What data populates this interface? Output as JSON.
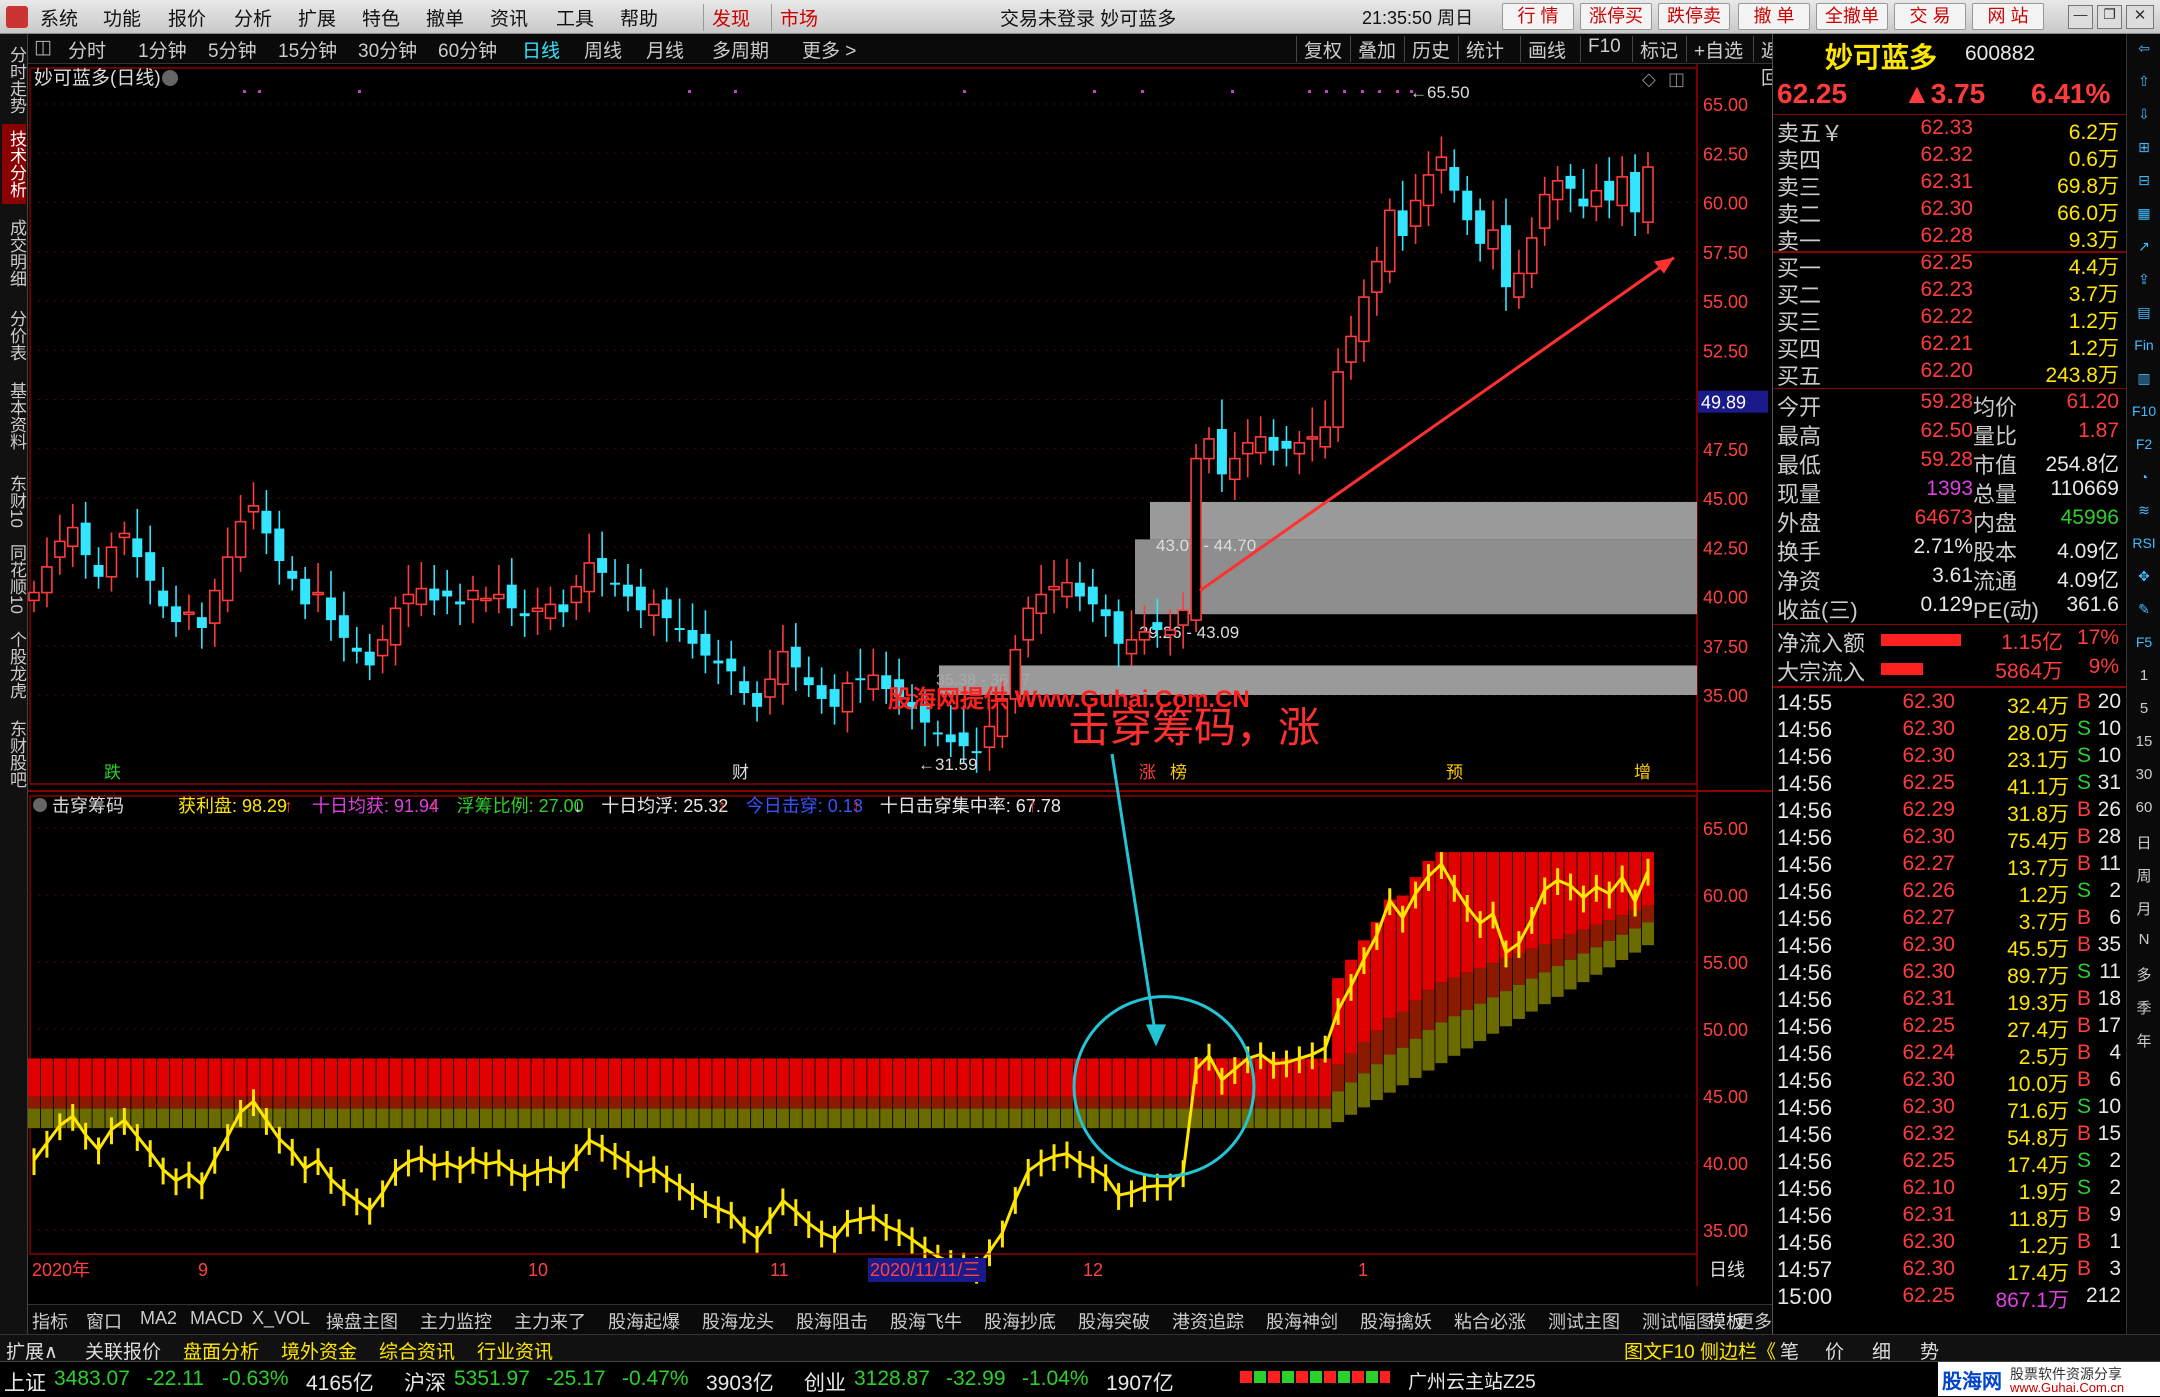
{
  "menu": [
    "系统",
    "功能",
    "报价",
    "分析",
    "扩展",
    "特色",
    "撤单",
    "资讯",
    "工具",
    "帮助"
  ],
  "menu_highlight": [
    "发现",
    "市场"
  ],
  "title": "交易未登录  妙可蓝多",
  "clock": "21:35:50 周日",
  "trade_buttons": [
    "行 情",
    "涨停买",
    "跌停卖",
    "撤 单",
    "全撤单",
    "交 易",
    "网 站"
  ],
  "left_tabs": [
    "分时走势",
    "技术分析",
    "成交明细",
    "分价表",
    "基本资料",
    "东财10",
    "同花顺10",
    "个股龙虎",
    "东财股吧"
  ],
  "periods": [
    "分时",
    "1分钟",
    "5分钟",
    "15分钟",
    "30分钟",
    "60分钟",
    "日线",
    "周线",
    "月线",
    "多周期",
    "更多 >"
  ],
  "tools": [
    "复权",
    "叠加",
    "历史",
    "统计",
    "画线",
    "F10",
    "标记",
    "+自选",
    "返回"
  ],
  "chart_title": "妙可蓝多(日线)",
  "annotations": {
    "high": "65.50",
    "low": "31.59",
    "zone_upper": "43.09 - 44.70",
    "zone_lower": "39.26 - 43.09",
    "zone_low2": "35.38 - 36.57",
    "watermark": "股海网提供 Www.Guhai.Com.CN",
    "caption": "击穿筹码，涨",
    "price_tag": "49.89"
  },
  "markers": [
    "跌",
    "财",
    "涨",
    "榜",
    "预",
    "增"
  ],
  "indicator": {
    "name": "击穿筹码",
    "items": [
      {
        "label": "获利盘: 98.29",
        "color": "#ffe600",
        "arrow": "↑"
      },
      {
        "label": "十日均获: 91.94",
        "color": "#e040e0",
        "arrow": "↑"
      },
      {
        "label": "浮筹比例: 27.00",
        "color": "#2bd02b",
        "arrow": "↓"
      },
      {
        "label": "十日均浮: 25.32",
        "color": "#e8e8e8",
        "arrow": "↑"
      },
      {
        "label": "今日击穿: 0.13",
        "color": "#3355ff",
        "arrow": "↑"
      },
      {
        "label": "十日击穿集中率: 67.78",
        "color": "#e8e8e8",
        "arrow": "↑"
      }
    ]
  },
  "x_axis": [
    "2020年",
    "9",
    "10",
    "11",
    "2020/11/11/三",
    "12",
    "1"
  ],
  "x_axis_right": "日线",
  "y_axis_main": [
    "65.00",
    "62.50",
    "60.00",
    "57.50",
    "55.00",
    "52.50",
    "50.00",
    "47.50",
    "45.00",
    "42.50",
    "40.00",
    "37.50",
    "35.00"
  ],
  "y_axis_ind": [
    "65.00",
    "60.00",
    "55.00",
    "50.00",
    "45.00",
    "40.00",
    "35.00"
  ],
  "chart_data": {
    "type": "candlestick",
    "title": "妙可蓝多(日线)",
    "ylim": [
      33.5,
      66.5
    ],
    "high": 65.5,
    "low": 31.59,
    "closes": [
      40.2,
      41.5,
      42.8,
      43.5,
      42.1,
      41.0,
      42.5,
      43.2,
      42.0,
      40.8,
      39.5,
      38.7,
      39.2,
      38.4,
      40.3,
      42.0,
      43.8,
      44.6,
      43.2,
      41.8,
      40.9,
      39.6,
      40.2,
      38.8,
      37.9,
      37.2,
      36.5,
      37.8,
      39.4,
      40.1,
      40.4,
      39.8,
      40.0,
      39.6,
      40.3,
      39.9,
      40.1,
      39.4,
      39.0,
      39.4,
      39.6,
      39.2,
      40.5,
      41.7,
      41.2,
      40.6,
      40.0,
      39.3,
      39.6,
      38.9,
      38.3,
      37.6,
      37.0,
      36.6,
      36.2,
      35.1,
      34.4,
      35.8,
      37.2,
      36.4,
      35.5,
      34.8,
      34.4,
      35.6,
      35.8,
      36.0,
      35.3,
      34.9,
      34.3,
      33.6,
      33.0,
      32.6,
      32.4,
      32.1,
      33.4,
      34.8,
      37.3,
      39.4,
      40.1,
      40.5,
      40.7,
      40.0,
      39.6,
      39.0,
      37.6,
      37.8,
      38.2,
      38.3,
      38.3,
      39.3,
      47.0,
      48.0,
      46.2,
      47.0,
      47.8,
      48.1,
      47.4,
      47.5,
      47.8,
      48.1,
      48.6,
      51.4,
      53.2,
      55.2,
      57.0,
      59.6,
      58.3,
      60.1,
      61.4,
      62.3,
      60.6,
      59.1,
      57.9,
      58.6,
      55.7,
      56.4,
      58.2,
      60.4,
      61.1,
      60.7,
      59.8,
      60.6,
      60.1,
      61.3,
      59.5,
      61.8
    ]
  },
  "right": {
    "name": "妙可蓝多",
    "code": "600882",
    "price": "62.25",
    "change": "▲3.75",
    "pct": "6.41%",
    "asks": [
      {
        "l": "卖五￥",
        "p": "62.33",
        "v": "6.2万"
      },
      {
        "l": "卖四",
        "p": "62.32",
        "v": "0.6万"
      },
      {
        "l": "卖三",
        "p": "62.31",
        "v": "69.8万"
      },
      {
        "l": "卖二",
        "p": "62.30",
        "v": "66.0万"
      },
      {
        "l": "卖一",
        "p": "62.28",
        "v": "9.3万"
      }
    ],
    "bids": [
      {
        "l": "买一",
        "p": "62.25",
        "v": "4.4万"
      },
      {
        "l": "买二",
        "p": "62.23",
        "v": "3.7万"
      },
      {
        "l": "买三",
        "p": "62.22",
        "v": "1.2万"
      },
      {
        "l": "买四",
        "p": "62.21",
        "v": "1.2万"
      },
      {
        "l": "买五",
        "p": "62.20",
        "v": "243.8万"
      }
    ],
    "stats": [
      {
        "a": "今开",
        "av": "59.28",
        "ac": "#ff3b3b",
        "b": "均价",
        "bv": "61.20",
        "bc": "#ff3b3b"
      },
      {
        "a": "最高",
        "av": "62.50",
        "ac": "#ff3b3b",
        "b": "量比",
        "bv": "1.87",
        "bc": "#ff3b3b"
      },
      {
        "a": "最低",
        "av": "59.28",
        "ac": "#ff3b3b",
        "b": "市值",
        "bv": "254.8亿",
        "bc": "#e8e8e8"
      },
      {
        "a": "现量",
        "av": "1393",
        "ac": "#e040e0",
        "b": "总量",
        "bv": "110669",
        "bc": "#e8e8e8"
      },
      {
        "a": "外盘",
        "av": "64673",
        "ac": "#ff3b3b",
        "b": "内盘",
        "bv": "45996",
        "bc": "#2bd02b"
      },
      {
        "a": "换手",
        "av": "2.71%",
        "ac": "#e8e8e8",
        "b": "股本",
        "bv": "4.09亿",
        "bc": "#e8e8e8"
      },
      {
        "a": "净资",
        "av": "3.61",
        "ac": "#e8e8e8",
        "b": "流通",
        "bv": "4.09亿",
        "bc": "#e8e8e8"
      },
      {
        "a": "收益(三)",
        "av": "0.129",
        "ac": "#e8e8e8",
        "b": "PE(动)",
        "bv": "361.6",
        "bc": "#e8e8e8"
      }
    ],
    "flows": [
      {
        "l": "净流入额",
        "v": "1.15亿",
        "p": "17%",
        "bar": 0.8
      },
      {
        "l": "大宗流入",
        "v": "5864万",
        "p": "9%",
        "bar": 0.42
      }
    ],
    "ticks": [
      [
        "14:55",
        "62.30",
        "32.4万",
        "B",
        "20"
      ],
      [
        "14:56",
        "62.30",
        "28.0万",
        "S",
        "10"
      ],
      [
        "14:56",
        "62.30",
        "23.1万",
        "S",
        "10"
      ],
      [
        "14:56",
        "62.25",
        "41.1万",
        "S",
        "31"
      ],
      [
        "14:56",
        "62.29",
        "31.8万",
        "B",
        "26"
      ],
      [
        "14:56",
        "62.30",
        "75.4万",
        "B",
        "28"
      ],
      [
        "14:56",
        "62.27",
        "13.7万",
        "B",
        "11"
      ],
      [
        "14:56",
        "62.26",
        "1.2万",
        "S",
        "2"
      ],
      [
        "14:56",
        "62.27",
        "3.7万",
        "B",
        "6"
      ],
      [
        "14:56",
        "62.30",
        "45.5万",
        "B",
        "35"
      ],
      [
        "14:56",
        "62.30",
        "89.7万",
        "S",
        "11"
      ],
      [
        "14:56",
        "62.31",
        "19.3万",
        "B",
        "18"
      ],
      [
        "14:56",
        "62.25",
        "27.4万",
        "B",
        "17"
      ],
      [
        "14:56",
        "62.24",
        "2.5万",
        "B",
        "4"
      ],
      [
        "14:56",
        "62.30",
        "10.0万",
        "B",
        "6"
      ],
      [
        "14:56",
        "62.30",
        "71.6万",
        "S",
        "10"
      ],
      [
        "14:56",
        "62.32",
        "54.8万",
        "B",
        "15"
      ],
      [
        "14:56",
        "62.25",
        "17.4万",
        "S",
        "2"
      ],
      [
        "14:56",
        "62.10",
        "1.9万",
        "S",
        "2"
      ],
      [
        "14:56",
        "62.31",
        "11.8万",
        "B",
        "9"
      ],
      [
        "14:56",
        "62.30",
        "1.2万",
        "B",
        "1"
      ],
      [
        "14:57",
        "62.30",
        "17.4万",
        "B",
        "3"
      ],
      [
        "15:00",
        "62.25",
        "867.1万",
        "",
        "212"
      ]
    ]
  },
  "farright_icons": [
    "⇦",
    "⇧",
    "⇩",
    "⊞",
    "⊟",
    "▦",
    "↗",
    "⇪",
    "▤",
    "Fin",
    "▥",
    "F10",
    "F2",
    "◔",
    "≋",
    "RSI",
    "✥",
    "✎",
    "F5",
    "1",
    "5",
    "15",
    "30",
    "60",
    "日",
    "周",
    "月",
    "N",
    "多",
    "季",
    "年"
  ],
  "bottom_tabs": [
    "指标",
    "窗口",
    "MA2",
    "MACD",
    "X_VOL",
    "操盘主图",
    "主力监控",
    "主力来了",
    "股海起爆",
    "股海龙头",
    "股海阻击",
    "股海飞牛",
    "股海抄底",
    "股海突破",
    "港资追踪",
    "股海神剑",
    "股海擒妖",
    "粘合必涨",
    "测试主图",
    "测试幅图",
    "更多",
    ">",
    "+",
    "−"
  ],
  "bottom_right": "模板",
  "status1": [
    "扩展∧",
    "关联报价",
    "盘面分析",
    "境外资金",
    "综合资讯",
    "行业资讯"
  ],
  "status1_right": [
    "图文F10",
    "侧边栏《",
    "笔",
    "价",
    "细",
    "势"
  ],
  "status2": [
    {
      "n": "上证",
      "v": "3483.07",
      "c": "-22.11",
      "p": "-0.63%",
      "a": "4165亿"
    },
    {
      "n": "沪深",
      "v": "5351.97",
      "c": "-25.17",
      "p": "-0.47%",
      "a": "3903亿"
    },
    {
      "n": "创业",
      "v": "3128.87",
      "c": "-32.99",
      "p": "-1.04%",
      "a": "1907亿"
    }
  ],
  "station": "广州云主站Z25",
  "brand": "股海网",
  "brand_sub": "股票软件资源分享",
  "brand_url": "www.Guhai.Com.cn"
}
